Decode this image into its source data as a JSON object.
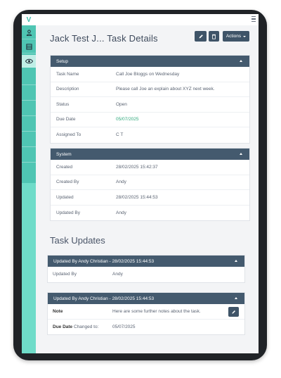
{
  "app": {
    "logo_letter": "V",
    "colors": {
      "accent": "#4fc5b3",
      "header": "#445a6e",
      "button": "#3f5468",
      "positive": "#2ea87b"
    }
  },
  "sidebar": {
    "icons": [
      "user-icon",
      "list-icon",
      "eye-icon"
    ],
    "active": "eye-icon"
  },
  "header": {
    "title": "Jack Test J... Task Details",
    "actions_label": "Actions",
    "icons": [
      "edit-icon",
      "trash-icon",
      "caret-down-icon",
      "menu-icon"
    ]
  },
  "setup": {
    "heading": "Setup",
    "rows": [
      {
        "label": "Task Name",
        "value": "Call Joe Bloggs on Wednesday"
      },
      {
        "label": "Description",
        "value": "Please call Joe an explain about XYZ next week."
      },
      {
        "label": "Status",
        "value": "Open"
      },
      {
        "label": "Due Date",
        "value": "05/07/2025"
      },
      {
        "label": "Assigned To",
        "value": "C T"
      }
    ]
  },
  "system": {
    "heading": "System",
    "rows": [
      {
        "label": "Created",
        "value": "28/02/2025 15:42:37"
      },
      {
        "label": "Created By",
        "value": "Andy"
      },
      {
        "label": "Updated",
        "value": "28/02/2025 15:44:53"
      },
      {
        "label": "Updated By",
        "value": "Andy"
      }
    ]
  },
  "updates": {
    "heading": "Task Updates",
    "items": [
      {
        "heading": "Updated By Andy Christian - 28/02/2025 15:44:53",
        "rows": [
          {
            "label": "Updated By",
            "value": "Andy"
          }
        ]
      },
      {
        "heading": "Updated By Andy Christian - 28/02/2025 15:44:53",
        "rows": [
          {
            "label": "Note",
            "value": "Here are some further notes about the task."
          },
          {
            "label_bold": "Due Date",
            "label_rest": " Changed to:",
            "value": "05/07/2025"
          }
        ]
      }
    ]
  }
}
